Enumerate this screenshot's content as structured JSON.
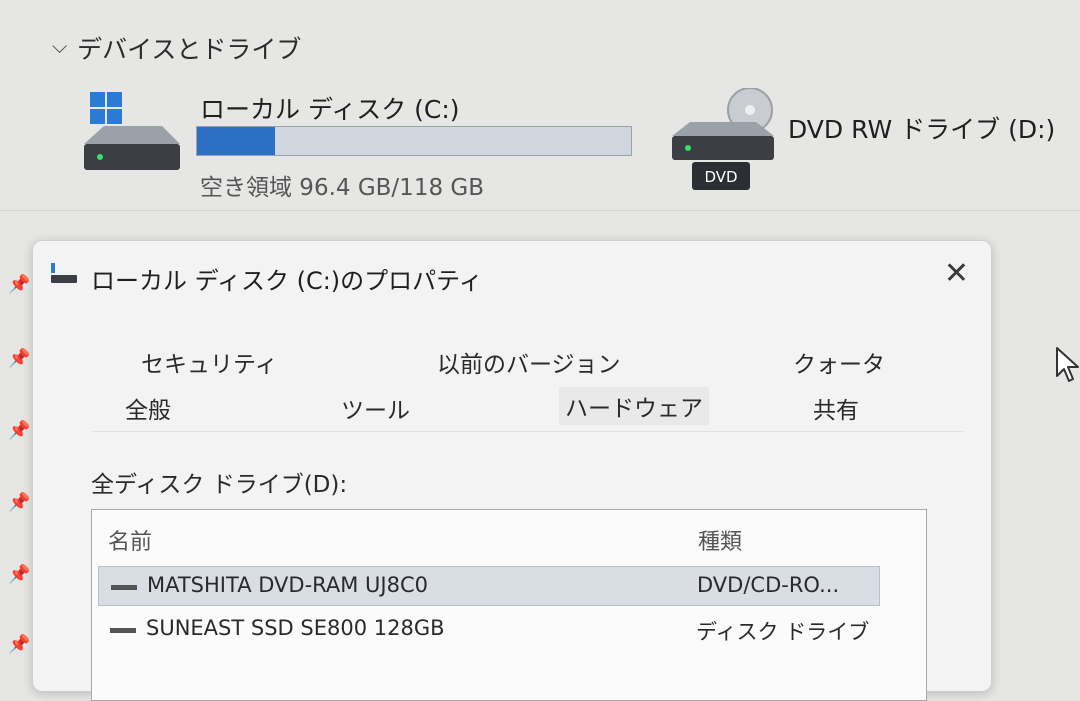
{
  "explorer": {
    "section_title": "デバイスとドライブ",
    "drive_c": {
      "name": "ローカル ディスク (C:)",
      "free_text": "空き領域 96.4 GB/118 GB",
      "used_fraction": 0.18
    },
    "drive_d": {
      "name": "DVD RW ドライブ (D:)",
      "icon_label": "DVD"
    }
  },
  "dialog": {
    "title": "ローカル ディスク (C:)のプロパティ",
    "close_glyph": "✕",
    "tabs_row1": [
      "セキュリティ",
      "以前のバージョン",
      "クォータ"
    ],
    "tabs_row2": [
      "全般",
      "ツール",
      "ハードウェア",
      "共有"
    ],
    "active_tab": "ハードウェア",
    "list_label": "全ディスク ドライブ(D):",
    "columns": {
      "name": "名前",
      "type": "種類"
    },
    "rows": [
      {
        "name": "MATSHITA DVD-RAM UJ8C0",
        "type": "DVD/CD-RO...",
        "selected": true
      },
      {
        "name": "SUNEAST SSD SE800 128GB",
        "type": "ディスク ドライブ",
        "selected": false
      }
    ]
  },
  "colors": {
    "accent": "#2d6fc4",
    "bar_bg": "#cfd6de",
    "selection": "#d9dde4"
  },
  "icons": [
    "chevron-down-icon",
    "windows-logo-icon",
    "hdd-icon",
    "dvd-drive-icon",
    "pin-icon",
    "close-icon",
    "mouse-cursor-icon"
  ]
}
